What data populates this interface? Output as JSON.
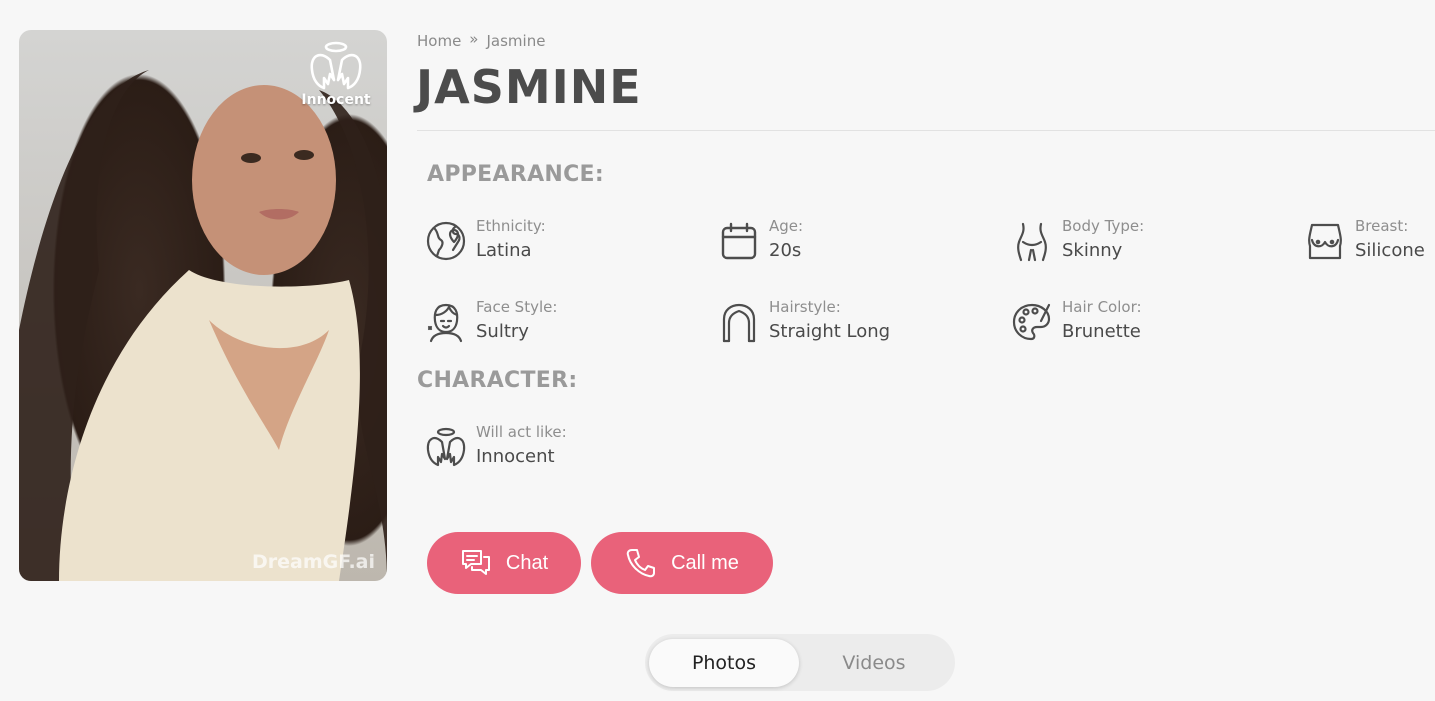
{
  "profile": {
    "badge_label": "Innocent",
    "watermark": "DreamGF.ai"
  },
  "breadcrumb": {
    "home": "Home",
    "separator": "»",
    "current": "Jasmine"
  },
  "title": "JASMINE",
  "appearance": {
    "heading": "APPEARANCE:",
    "items": [
      {
        "label": "Ethnicity:",
        "value": "Latina",
        "icon": "globe-icon"
      },
      {
        "label": "Age:",
        "value": "20s",
        "icon": "calendar-icon"
      },
      {
        "label": "Body Type:",
        "value": "Skinny",
        "icon": "body-icon"
      },
      {
        "label": "Breast:",
        "value": "Silicone",
        "icon": "breast-icon"
      },
      {
        "label": "Face Style:",
        "value": "Sultry",
        "icon": "face-icon"
      },
      {
        "label": "Hairstyle:",
        "value": "Straight Long",
        "icon": "hairstyle-icon"
      },
      {
        "label": "Hair Color:",
        "value": "Brunette",
        "icon": "palette-icon"
      }
    ]
  },
  "character": {
    "heading": "CHARACTER:",
    "items": [
      {
        "label": "Will act like:",
        "value": "Innocent",
        "icon": "angel-icon"
      }
    ]
  },
  "actions": {
    "chat": "Chat",
    "call": "Call me"
  },
  "tabs": {
    "photos": "Photos",
    "videos": "Videos",
    "active": "Photos"
  },
  "colors": {
    "accent": "#e9627a",
    "heading": "#9a9a9a",
    "background": "#f7f7f7"
  }
}
